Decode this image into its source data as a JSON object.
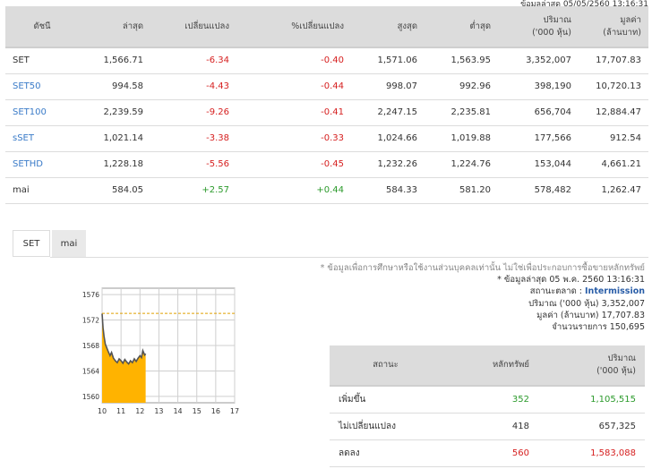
{
  "updated": "ข้อมูลล่าสุด 05/05/2560 13:16:31",
  "colors": {
    "up": "#2b9a2b",
    "down": "#d62020",
    "link": "#3a7bc8",
    "area": "#ffb300"
  },
  "index_table": {
    "headers": {
      "name": "ดัชนี",
      "last": "ล่าสุด",
      "change": "เปลี่ยนแปลง",
      "pct_change": "%เปลี่ยนแปลง",
      "high": "สูงสุด",
      "low": "ต่ำสุด",
      "volume_l1": "ปริมาณ",
      "volume_l2": "('000 หุ้น)",
      "value_l1": "มูลค่า",
      "value_l2": "(ล้านบาท)"
    },
    "rows": [
      {
        "name": "SET",
        "last": "1,566.71",
        "change": "-6.34",
        "pct": "-0.40",
        "high": "1,571.06",
        "low": "1,563.95",
        "volume": "3,352,007",
        "value": "17,707.83"
      },
      {
        "name": "SET50",
        "last": "994.58",
        "change": "-4.43",
        "pct": "-0.44",
        "high": "998.07",
        "low": "992.96",
        "volume": "398,190",
        "value": "10,720.13"
      },
      {
        "name": "SET100",
        "last": "2,239.59",
        "change": "-9.26",
        "pct": "-0.41",
        "high": "2,247.15",
        "low": "2,235.81",
        "volume": "656,704",
        "value": "12,884.47"
      },
      {
        "name": "sSET",
        "last": "1,021.14",
        "change": "-3.38",
        "pct": "-0.33",
        "high": "1,024.66",
        "low": "1,019.88",
        "volume": "177,566",
        "value": "912.54"
      },
      {
        "name": "SETHD",
        "last": "1,228.18",
        "change": "-5.56",
        "pct": "-0.45",
        "high": "1,232.26",
        "low": "1,224.76",
        "volume": "153,044",
        "value": "4,661.21"
      },
      {
        "name": "mai",
        "last": "584.05",
        "change": "+2.57",
        "pct": "+0.44",
        "high": "584.33",
        "low": "581.20",
        "volume": "578,482",
        "value": "1,262.47"
      }
    ]
  },
  "tabs": {
    "set": "SET",
    "mai": "mai"
  },
  "chart_data": {
    "type": "area",
    "x_ticks": [
      "10",
      "11",
      "12",
      "13",
      "14",
      "15",
      "16",
      "17"
    ],
    "y_ticks": [
      "1560",
      "1564",
      "1568",
      "1572",
      "1576"
    ],
    "ylim": [
      1559,
      1577
    ],
    "xlim": [
      10,
      17
    ],
    "prev_close": 1573.05,
    "x": [
      10.0,
      10.05,
      10.1,
      10.17,
      10.25,
      10.33,
      10.42,
      10.5,
      10.6,
      10.7,
      10.8,
      10.9,
      11.0,
      11.1,
      11.2,
      11.3,
      11.4,
      11.5,
      11.6,
      11.7,
      11.8,
      11.9,
      12.0,
      12.08,
      12.15,
      12.25,
      12.3
    ],
    "values": [
      1573.0,
      1570.8,
      1569.5,
      1568.2,
      1567.6,
      1567.0,
      1566.4,
      1566.9,
      1566.0,
      1565.6,
      1565.3,
      1565.9,
      1565.6,
      1565.2,
      1565.8,
      1565.4,
      1565.1,
      1565.6,
      1565.3,
      1565.9,
      1565.5,
      1566.0,
      1566.4,
      1566.1,
      1567.2,
      1566.5,
      1566.7
    ]
  },
  "market_info": {
    "disclaimer": "* ข้อมูลเพื่อการศึกษาหรือใช้งานส่วนบุคคลเท่านั้น ไม่ใช่เพื่อประกอบการซื้อขายหลักทรัพย์",
    "last_update": "* ข้อมูลล่าสุด 05 พ.ค. 2560 13:16:31",
    "status_label": "สถานะตลาด :",
    "status_value": "Intermission",
    "volume_label": "ปริมาณ ('000 หุ้น)",
    "volume_value": "3,352,007",
    "value_label": "มูลค่า (ล้านบาท)",
    "value_value": "17,707.83",
    "trades_label": "จำนวนรายการ",
    "trades_value": "150,695"
  },
  "market_table": {
    "headers": {
      "status": "สถานะ",
      "securities": "หลักทรัพย์",
      "volume_l1": "ปริมาณ",
      "volume_l2": "('000 หุ้น)"
    },
    "rows": [
      {
        "status": "เพิ่มขึ้น",
        "securities": "352",
        "volume": "1,105,515",
        "tone": "up"
      },
      {
        "status": "ไม่เปลี่ยนแปลง",
        "securities": "418",
        "volume": "657,325",
        "tone": "flat"
      },
      {
        "status": "ลดลง",
        "securities": "560",
        "volume": "1,583,088",
        "tone": "down"
      }
    ]
  }
}
